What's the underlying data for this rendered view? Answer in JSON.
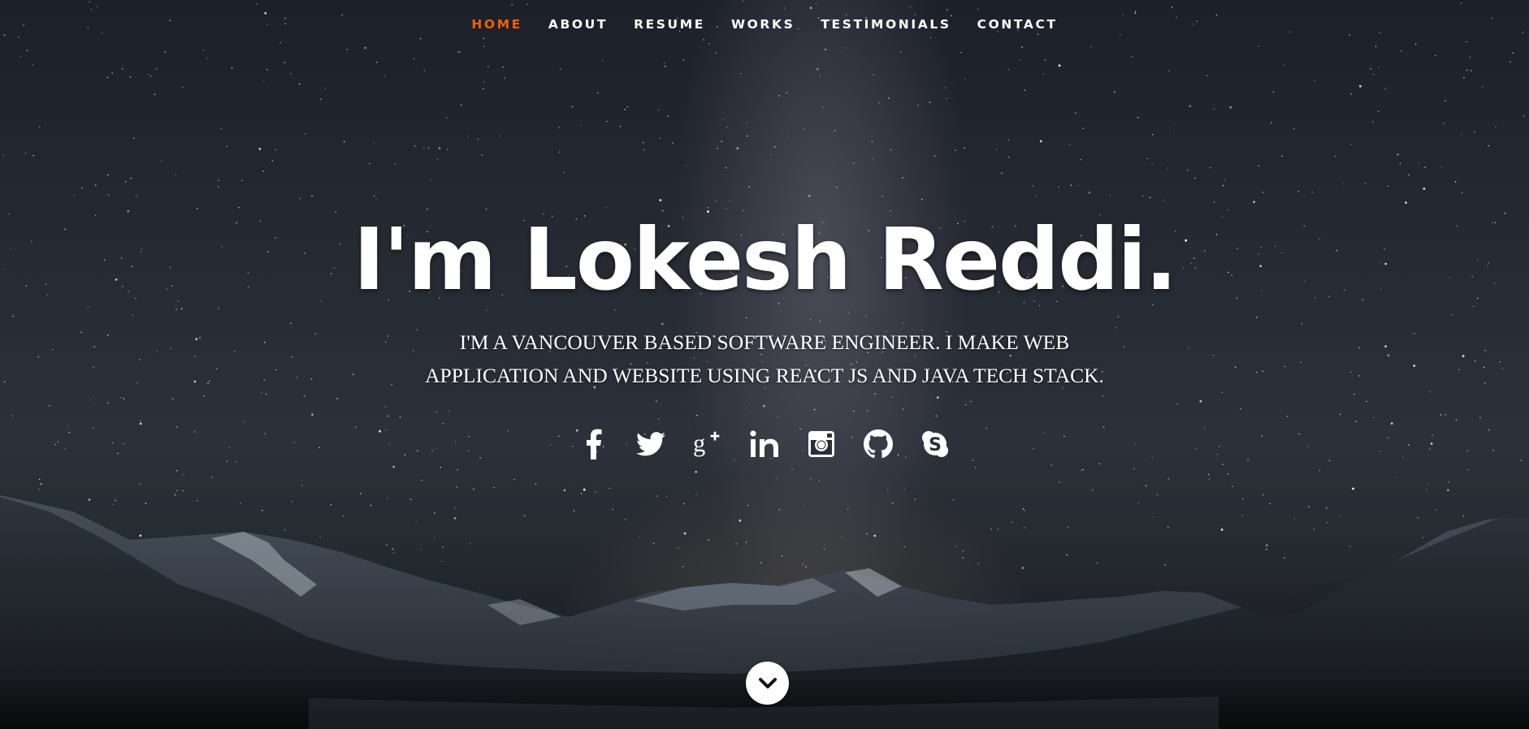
{
  "nav": {
    "items": [
      {
        "label": "HOME",
        "active": true
      },
      {
        "label": "ABOUT",
        "active": false
      },
      {
        "label": "RESUME",
        "active": false
      },
      {
        "label": "WORKS",
        "active": false
      },
      {
        "label": "TESTIMONIALS",
        "active": false
      },
      {
        "label": "CONTACT",
        "active": false
      }
    ],
    "active_color": "#f06000",
    "text_color": "#ffffff"
  },
  "banner": {
    "headline": "I'm Lokesh Reddi.",
    "tagline": "I'm a Vancouver based software engineer. I make web application and website using React JS and Java tech stack."
  },
  "social": [
    {
      "icon": "facebook-icon"
    },
    {
      "icon": "twitter-icon"
    },
    {
      "icon": "google-plus-icon"
    },
    {
      "icon": "linkedin-icon"
    },
    {
      "icon": "instagram-icon"
    },
    {
      "icon": "github-icon"
    },
    {
      "icon": "skype-icon"
    }
  ],
  "scroll_down": {
    "icon": "chevron-down-icon"
  },
  "background": {
    "description_icon": "starry-mountain-landscape"
  }
}
